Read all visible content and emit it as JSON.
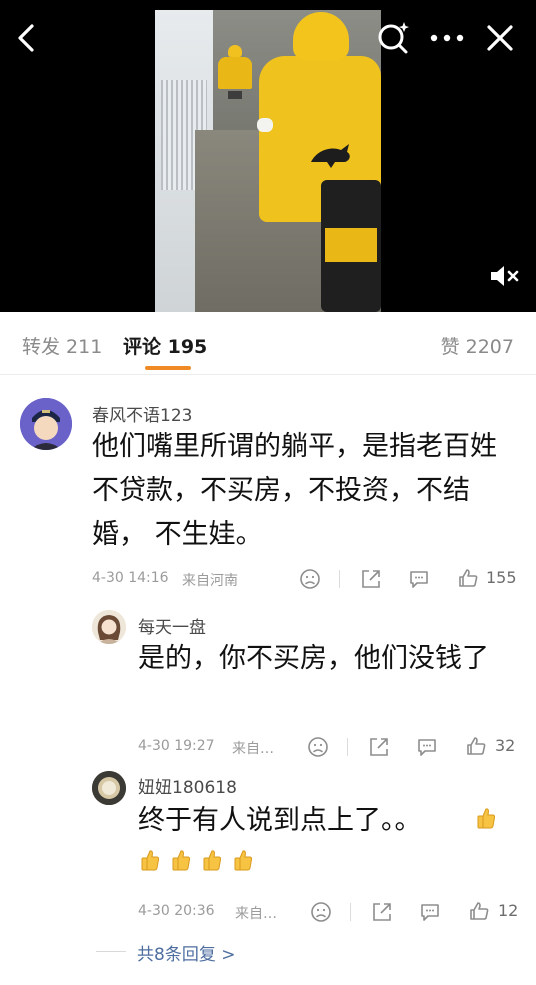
{
  "tabs": {
    "repost": "转发 211",
    "comments": "评论 195",
    "likes": "赞 2207"
  },
  "comment": {
    "author": "春风不语123",
    "text": "他们嘴里所谓的躺平，是指老百姓不贷款，不买房，不投资，不结婚， 不生娃。",
    "time": "4-30 14:16",
    "location": "来自河南",
    "likes": "155"
  },
  "replies": [
    {
      "author": "每天一盘",
      "text": "是的，你不买房，他们没钱了",
      "time": "4-30 19:27",
      "location": "来自…",
      "likes": "32"
    },
    {
      "author": "妞妞180618",
      "text": "终于有人说到点上了。。",
      "time": "4-30 20:36",
      "location": "来自…",
      "likes": "12"
    }
  ],
  "replies_link": "共8条回复 >",
  "icons": {
    "video": [
      "back-icon",
      "star-search-icon",
      "more-icon",
      "close-icon",
      "mute-icon"
    ],
    "actions": [
      "dislike-face-icon",
      "share-icon",
      "comment-icon",
      "thumbs-up-icon"
    ],
    "emoji": "thumbs-up-emoji"
  },
  "colors": {
    "tab_underline": "#f08a24",
    "link": "#4e6ea0",
    "uniform_yellow": "#f0c21d"
  }
}
